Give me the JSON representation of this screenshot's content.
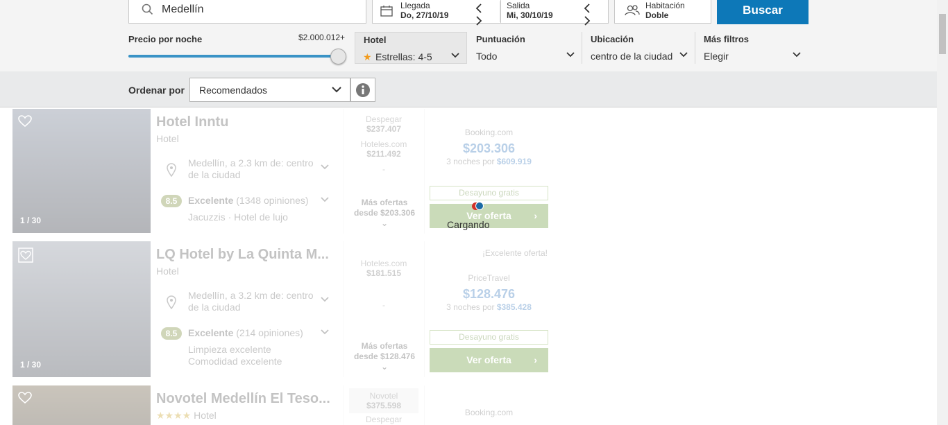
{
  "search": {
    "destination": "Medellín"
  },
  "dates": {
    "checkin_label": "Llegada",
    "checkin_value": "Do, 27/10/19",
    "checkout_label": "Salida",
    "checkout_value": "Mi, 30/10/19"
  },
  "room": {
    "label": "Habitación",
    "value": "Doble"
  },
  "search_button": "Buscar",
  "filters": {
    "price_label": "Precio por noche",
    "price_value": "$2.000.012+",
    "price_level": 1.0,
    "hotel_title": "Hotel",
    "hotel_value": "Estrellas: 4-5",
    "score_title": "Puntuación",
    "score_value": "Todo",
    "location_title": "Ubicación",
    "location_value": "centro de la ciudad",
    "more_title": "Más filtros",
    "more_value": "Elegir"
  },
  "sort": {
    "label": "Ordenar por",
    "value": "Recomendados"
  },
  "loading_text": "Cargando",
  "results": [
    {
      "name": "Hotel Inntu",
      "type": "Hotel",
      "photo_count": "1 / 30",
      "location": "Medellín, a 2.3 km de: centro de la ciudad",
      "score": "8.5",
      "rating_word": "Excelente",
      "reviews": "(1348 opiniones)",
      "extras": "Jacuzzis · Hotel de lujo",
      "offers": [
        {
          "site": "Despegar",
          "price": "$237.407"
        },
        {
          "site": "Hoteles.com",
          "price": "$211.492"
        }
      ],
      "offers_dots": "-",
      "more_offers": "Más ofertas",
      "more_from": "desde $203.306",
      "provider": "Booking.com",
      "price": "$203.306",
      "nights_text": "3 noches por",
      "nights_total": "$609.919",
      "breakfast": "Desayuno gratis",
      "deal": "Ver oferta"
    },
    {
      "name": "LQ Hotel by La Quinta M...",
      "type": "Hotel",
      "photo_count": "1 / 30",
      "excellent": "¡Excelente oferta!",
      "location": "Medellín, a 3.2 km de: centro de la ciudad",
      "score": "8.5",
      "rating_word": "Excelente",
      "reviews": "(214 opiniones)",
      "extras": "Limpieza excelente\nComodidad excelente",
      "offers": [
        {
          "site": "Hoteles.com",
          "price": "$181.515"
        }
      ],
      "offers_dots": "-",
      "more_offers": "Más ofertas",
      "more_from": "desde $128.476",
      "provider": "PriceTravel",
      "price": "$128.476",
      "nights_text": "3 noches por",
      "nights_total": "$385.428",
      "breakfast": "Desayuno gratis",
      "deal": "Ver oferta"
    },
    {
      "name": "Novotel Medellín El Teso...",
      "type": "Hotel",
      "stars": "★★★★",
      "offers": [
        {
          "site": "Novotel",
          "price": "$375.598"
        },
        {
          "site": "Despegar",
          "price": ""
        }
      ],
      "provider": "Booking.com"
    }
  ],
  "colors": {
    "accent": "#0d78b8",
    "slider": "#3a93c6",
    "deal_green": "#6a9b38",
    "price_blue": "#3a7abf",
    "star": "#f29b1d",
    "loader_red": "#d0332b",
    "loader_blue": "#1b6aa5"
  },
  "icons": [
    "search-icon",
    "calendar-icon",
    "chevron-left-icon",
    "chevron-right-icon",
    "users-icon",
    "star-icon",
    "chevron-down-icon",
    "info-icon",
    "heart-icon",
    "location-pin-icon"
  ]
}
